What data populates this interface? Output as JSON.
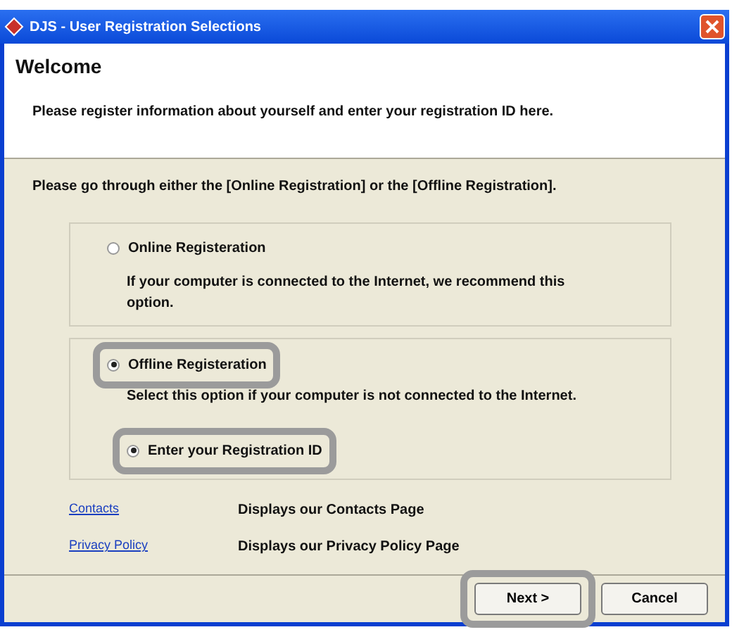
{
  "window": {
    "title": "DJS - User Registration Selections"
  },
  "header": {
    "title": "Welcome",
    "text": "Please register information about yourself and enter your registration ID here."
  },
  "instruction": "Please go through either the [Online Registration] or the [Offline Registration].",
  "options": [
    {
      "label": "Online Registeration",
      "selected": false,
      "highlighted": false,
      "description": "If your computer is connected to the Internet, we recommend this option."
    },
    {
      "label": "Offline Registeration",
      "selected": true,
      "highlighted": true,
      "description": "Select this option if your computer is not connected to the Internet.",
      "sub_options": [
        {
          "label": "Enter your Registration ID",
          "selected": true,
          "highlighted": true
        }
      ]
    }
  ],
  "links": [
    {
      "label": "Contacts",
      "description": "Displays our Contacts Page"
    },
    {
      "label": "Privacy Policy",
      "description": "Displays our Privacy Policy Page"
    }
  ],
  "buttons": [
    {
      "label": "Next >",
      "highlighted": true
    },
    {
      "label": "Cancel",
      "highlighted": false
    }
  ]
}
